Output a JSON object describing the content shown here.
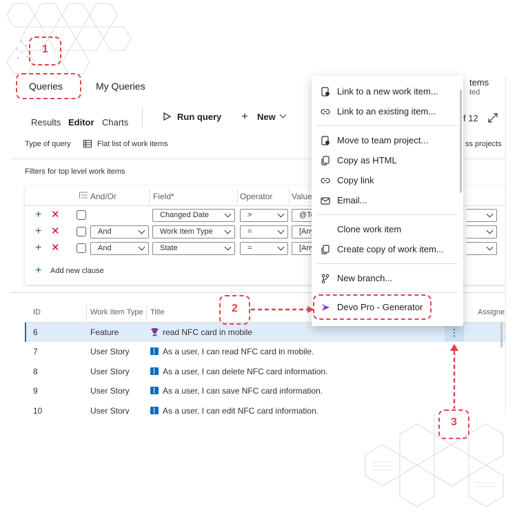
{
  "colors": {
    "accent": "#0f6cbd",
    "annotation": "#e0434b",
    "add_green": "#107c10",
    "delete_red": "#c50f1f"
  },
  "header": {
    "tabs": [
      "Queries",
      "My Queries"
    ],
    "right_title_fragment": "tems",
    "right_subtitle_fragment": "ted"
  },
  "toolbar": {
    "subtabs": [
      "Results",
      "Editor",
      "Charts"
    ],
    "run_query": "Run query",
    "new": "New",
    "pager": "f 12"
  },
  "query_type": {
    "label": "Type of query",
    "value": "Flat list of work items",
    "right_fragment": "ss projects"
  },
  "filters": {
    "heading": "Filters for top level work items",
    "columns": {
      "andor": "And/Or",
      "field": "Field*",
      "operator": "Operator",
      "value": "Value"
    },
    "rows": [
      {
        "andor": "",
        "field": "Changed Date",
        "operator": ">",
        "value": "@To"
      },
      {
        "andor": "And",
        "field": "Work Item Type",
        "operator": "=",
        "value": "[Any"
      },
      {
        "andor": "And",
        "field": "State",
        "operator": "=",
        "value": "[Any"
      }
    ],
    "add_clause": "Add new clause"
  },
  "results": {
    "columns": {
      "id": "ID",
      "type": "Work Item Type",
      "title": "Title",
      "assigned": "Assigne"
    },
    "rows": [
      {
        "id": "6",
        "type": "Feature",
        "title": "read NFC card in mobile",
        "icon": "trophy-icon"
      },
      {
        "id": "7",
        "type": "User Story",
        "title": "As a user, I can read NFC card in mobile.",
        "icon": "book-icon"
      },
      {
        "id": "8",
        "type": "User Story",
        "title": "As a user, I can delete NFC card information.",
        "icon": "book-icon"
      },
      {
        "id": "9",
        "type": "User Story",
        "title": "As a user, I can save NFC card information.",
        "icon": "book-icon"
      },
      {
        "id": "10",
        "type": "User Story",
        "title": "As a user, I can edit NFC card information.",
        "icon": "book-icon"
      }
    ],
    "more_icon": "⋮"
  },
  "context_menu": {
    "items": [
      {
        "label": "Link to a new work item...",
        "icon": "link-new-icon"
      },
      {
        "label": "Link to an existing item...",
        "icon": "link-icon"
      },
      {
        "label": "Move to team project...",
        "icon": "move-icon"
      },
      {
        "label": "Copy as HTML",
        "icon": "copy-icon"
      },
      {
        "label": "Copy link",
        "icon": "link-icon"
      },
      {
        "label": "Email...",
        "icon": "mail-icon"
      },
      {
        "label": "Clone work item",
        "icon": ""
      },
      {
        "label": "Create copy of work item...",
        "icon": "copy-icon"
      },
      {
        "label": "New branch...",
        "icon": "branch-icon"
      },
      {
        "label": "Devo Pro - Generator",
        "icon": "devo-pro-icon"
      }
    ]
  },
  "annotations": [
    "1",
    "2",
    "3"
  ]
}
